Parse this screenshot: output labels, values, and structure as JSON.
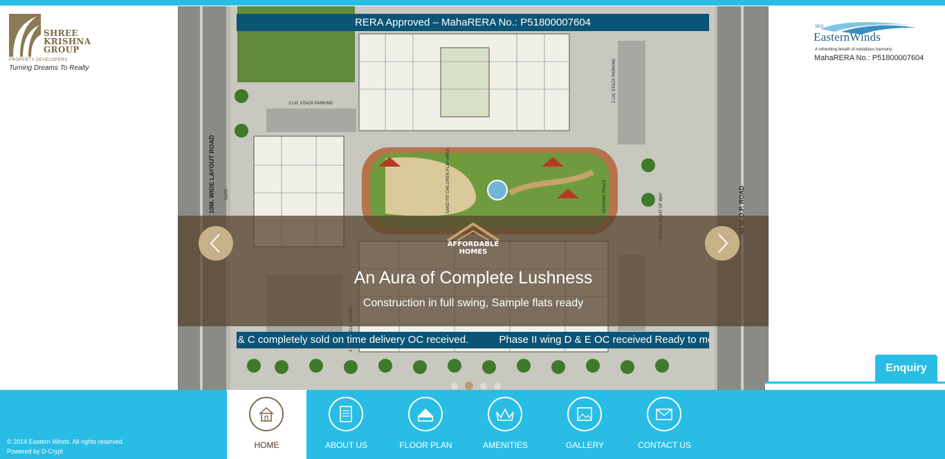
{
  "brand_left": {
    "name": "SHREE\nKRISHNA\nGROUP",
    "subtitle": "PROPERTY DEVELOPERS",
    "tagline": "Turning Dreams To Realty"
  },
  "brand_right": {
    "prefix": "SKG",
    "name": "EasternWinds",
    "tagline": "A refreshing breath of melodious harmony",
    "rera": "MahaRERA No.: P51800007604"
  },
  "hero": {
    "rera_banner": "RERA Approved – MahaRERA No.: P51800007604",
    "plan_labels": {
      "road_left": "10M. WIDE LAYOUT ROAD",
      "road_right": "43 M. D.P. ROAD",
      "parking_top": "2 LVL STACK PARKING",
      "parking_right": "2 LVL STACK PARKING",
      "puzzle": "2 LVL PUZZLE PARKING",
      "sand_pit": "SAND PIT\nCHILDREN PLAY AREA",
      "jogging": "JOGGING TRACK",
      "gate": "GATE",
      "right_of_way": "4M WIDE RIGHT OF WAY"
    },
    "badge": "AFFORDABLE\nHOMES",
    "title": "An Aura of Complete Lushness",
    "subtitle": "Construction in full swing, Sample flats ready",
    "ticker": [
      "Phase I wing A, B & C completely sold on time delivery OC received.",
      "Phase II wing D & E OC received Ready to move in."
    ],
    "slides": {
      "count": 4,
      "active": 2
    }
  },
  "nav": [
    {
      "label": "HOME",
      "icon": "home-icon",
      "active": true
    },
    {
      "label": "ABOUT US",
      "icon": "document-icon",
      "active": false
    },
    {
      "label": "FLOOR PLAN",
      "icon": "floor-plan-icon",
      "active": false
    },
    {
      "label": "AMENITIES",
      "icon": "crown-icon",
      "active": false
    },
    {
      "label": "GALLERY",
      "icon": "picture-icon",
      "active": false
    },
    {
      "label": "CONTACT US",
      "icon": "envelope-icon",
      "active": false
    }
  ],
  "footer": {
    "copyright": "© 2014 Eastern Winds. All rights reserved.",
    "powered": "Powered by D-Crypt"
  },
  "enquiry": "Enquiry",
  "colors": {
    "accent": "#29bde6",
    "banner": "#0a5476",
    "gold": "#c7b188",
    "brand_brown": "#7a6a47"
  }
}
